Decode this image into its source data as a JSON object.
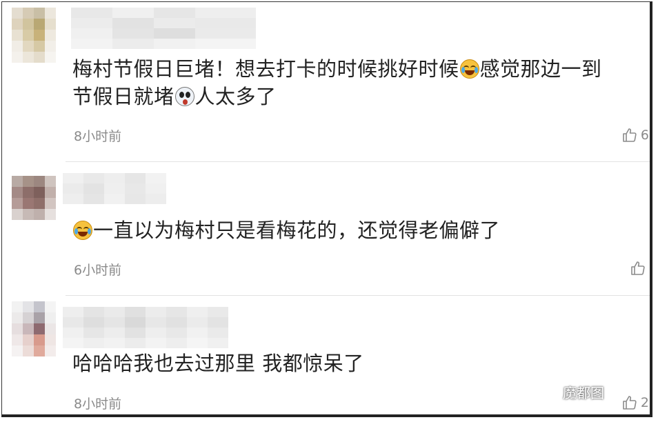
{
  "comments": [
    {
      "parts": [
        "梅村节假日巨堵！想去打卡的时候挑好时候",
        "感觉那边一到",
        "节假日就堵",
        "人太多了"
      ],
      "time": "8小时前",
      "likes": "6"
    },
    {
      "parts": [
        "一直以为梅村只是看梅花的，还觉得老偏僻了"
      ],
      "time": "6小时前",
      "likes": ""
    },
    {
      "parts": [
        "哈哈哈我也去过那里 我都惊呆了"
      ],
      "time": "8小时前",
      "likes": "2"
    }
  ],
  "icons": {
    "like": "thumbs-up-icon",
    "emoji_1": "laughing-crying-emoji-icon",
    "emoji_2": "scared-emoji-icon",
    "watermark": "wechat-icon"
  },
  "watermark": {
    "text": "魔都图"
  },
  "colors": {
    "text": "#222222",
    "meta": "#8a8a8a",
    "divider": "#e2e2e2"
  }
}
